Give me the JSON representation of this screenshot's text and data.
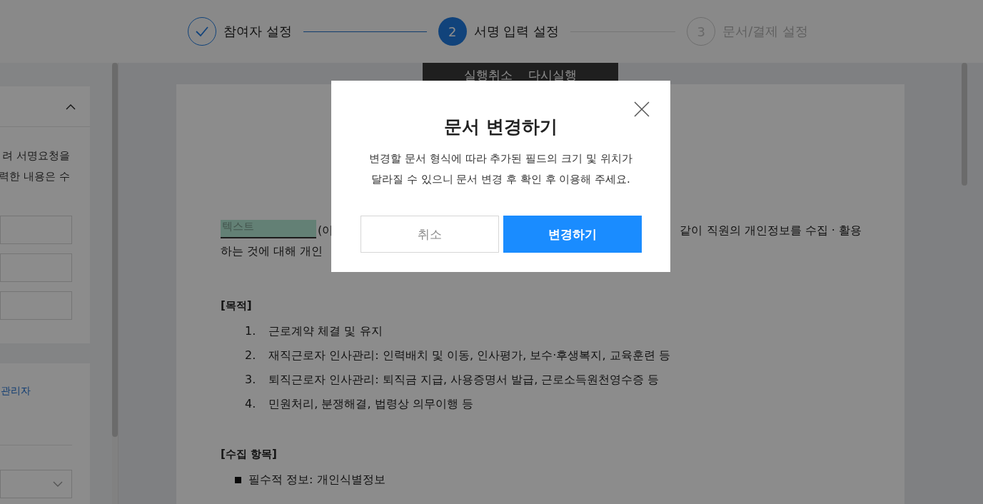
{
  "steps": [
    {
      "label": "참여자 설정",
      "kind": "done"
    },
    {
      "number": "2",
      "label": "서명 입력 설정",
      "kind": "current"
    },
    {
      "number": "3",
      "label": "문서/결제 설정",
      "kind": "upcoming"
    }
  ],
  "toolbar": {
    "undo": "실행취소",
    "redo": "다시실행"
  },
  "left_panel": {
    "section": {
      "expanded": true,
      "lines": [
        "려 서명요청을",
        "력한 내용은 수"
      ]
    },
    "link": "관리자"
  },
  "document": {
    "field_label": "텍스트",
    "line1_start": "(이",
    "line1_end": "같이 직원의 개인정보를 수집 · 활용",
    "line2": "하는 것에 대해 개인",
    "purpose_heading": "[목적]",
    "purpose_items": [
      {
        "number": "1.",
        "text": "근로계약 체결 및 유지"
      },
      {
        "number": "2.",
        "text": "재직근로자 인사관리: 인력배치 및 이동, 인사평가, 보수·후생복지, 교육훈련 등"
      },
      {
        "number": "3.",
        "text": "퇴직근로자 인사관리: 퇴직금 지급, 사용증명서 발급, 근로소득원천영수증 등"
      },
      {
        "number": "4.",
        "text": "민원처리, 분쟁해결, 법령상 의무이행 등"
      }
    ],
    "items_heading": "[수집 항목]",
    "bullets": [
      "필수적 정보: 개인식별정보"
    ]
  },
  "modal": {
    "title": "문서 변경하기",
    "message": [
      "변경할 문서 형식에 따라 추가된 필드의 크기 및 위치가",
      "달라질 수 있으니 문서 변경 후 확인 후 이용해 주세요."
    ],
    "cancel": "취소",
    "confirm": "변경하기"
  }
}
